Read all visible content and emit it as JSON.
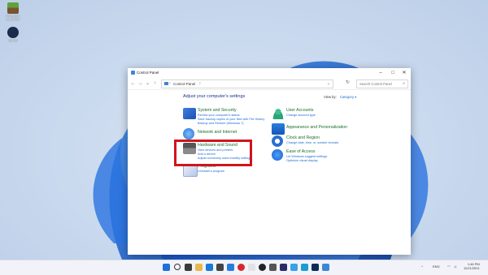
{
  "desktop": {
    "icons": [
      {
        "label": "Minecraft Launcher",
        "color": "#4c8c2b"
      },
      {
        "label": "Steam",
        "color": "#1b2b4a"
      }
    ]
  },
  "window": {
    "title": "Control Panel",
    "breadcrumb": "Control Panel",
    "search_placeholder": "Search Control Panel",
    "heading": "Adjust your computer's settings",
    "view_by_label": "View by:",
    "view_by_value": "Category"
  },
  "categories": {
    "system_security": {
      "title": "System and Security",
      "links": [
        "Review your computer's status",
        "Save backup copies of your files with File History",
        "Backup and Restore (Windows 7)"
      ]
    },
    "network": {
      "title": "Network and Internet"
    },
    "hardware_sound": {
      "title": "Hardware and Sound",
      "links": [
        "View devices and printers",
        "Add a device",
        "Adjust commonly used mobility settings"
      ]
    },
    "programs": {
      "title": "Programs",
      "links": [
        "Uninstall a program"
      ]
    },
    "user_accounts": {
      "title": "User Accounts",
      "links": [
        "Change account type"
      ]
    },
    "appearance": {
      "title": "Appearance and Personalization"
    },
    "clock_region": {
      "title": "Clock and Region",
      "links": [
        "Change date, time, or number formats"
      ]
    },
    "ease_access": {
      "title": "Ease of Access",
      "links": [
        "Let Windows suggest settings",
        "Optimize visual display"
      ]
    }
  },
  "taskbar": {
    "tray_time": "1:46 PM",
    "tray_date": "11/21/2021",
    "tray_lang": "ENG"
  },
  "colors": {
    "accent": "#1a6ad3",
    "category_title": "#1e6e2a",
    "heading": "#1e3287",
    "highlight": "#d0141c"
  }
}
